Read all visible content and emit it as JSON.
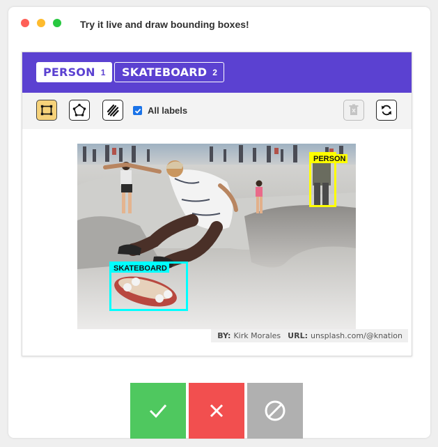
{
  "window": {
    "title": "Try it live and draw bounding boxes!"
  },
  "labels": [
    {
      "name": "PERSON",
      "count": "1",
      "state": "active"
    },
    {
      "name": "SKATEBOARD",
      "count": "2",
      "state": "outline"
    }
  ],
  "toolbar": {
    "tools": [
      "bounding-box-icon",
      "polygon-icon",
      "brush-icon"
    ],
    "all_labels_text": "All labels",
    "all_labels_checked": true,
    "delete_icon": "trash-icon",
    "reset_icon": "refresh-icon"
  },
  "annotations": [
    {
      "label": "PERSON",
      "color": "#ffff00"
    },
    {
      "label": "SKATEBOARD",
      "color": "#00ffff"
    }
  ],
  "credit": {
    "by_label": "BY:",
    "by_value": "Kirk Morales",
    "url_label": "URL:",
    "url_value": "unsplash.com/@knation"
  },
  "actions": [
    {
      "name": "accept",
      "icon": "check-icon",
      "color": "#4fc85f"
    },
    {
      "name": "reject",
      "icon": "x-icon",
      "color": "#f24f4f"
    },
    {
      "name": "skip",
      "icon": "ban-icon",
      "color": "#b0b0b0"
    }
  ],
  "colors": {
    "accent": "#5b41d1",
    "selected_tool": "#f6d27a"
  }
}
